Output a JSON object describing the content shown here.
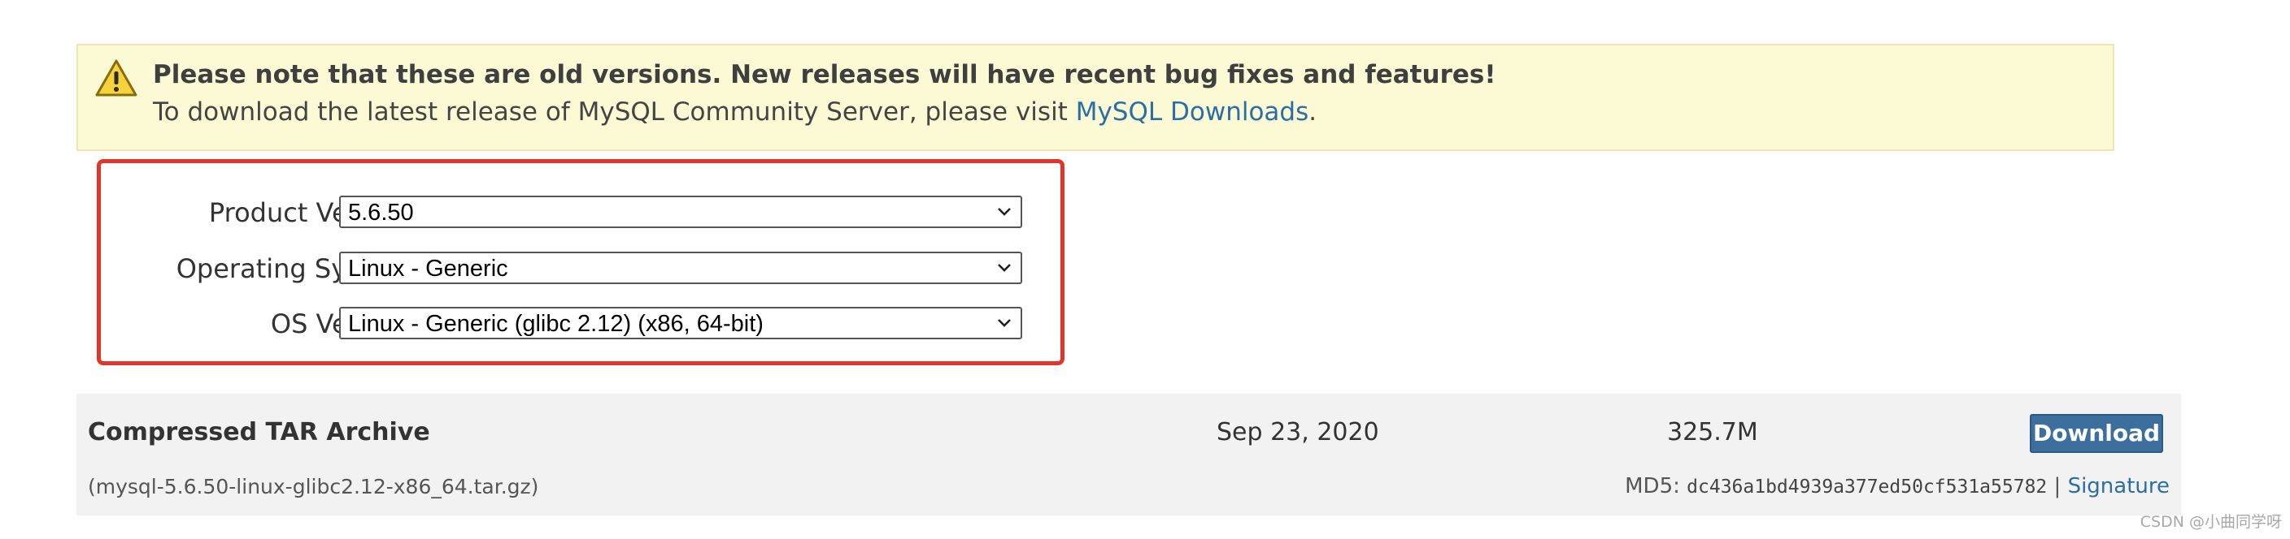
{
  "notice": {
    "headline": "Please note that these are old versions. New releases will have recent bug fixes and features!",
    "body_prefix": "To download the latest release of MySQL Community Server, please visit ",
    "link_text": "MySQL Downloads",
    "body_suffix": ".",
    "icon": "warning-icon"
  },
  "selectors": {
    "product_version": {
      "label": "Product Version:",
      "value": "5.6.50"
    },
    "operating_system": {
      "label": "Operating System:",
      "value": "Linux - Generic"
    },
    "os_version": {
      "label": "OS Version:",
      "value": "Linux - Generic (glibc 2.12) (x86, 64-bit)"
    }
  },
  "package": {
    "name": "Compressed TAR Archive",
    "date": "Sep 23, 2020",
    "size": "325.7M",
    "download_label": "Download",
    "filename": "(mysql-5.6.50-linux-glibc2.12-x86_64.tar.gz)",
    "md5_label": "MD5: ",
    "md5": "dc436a1bd4939a377ed50cf531a55782",
    "separator": " | ",
    "signature_label": "Signature"
  },
  "watermark": "CSDN @小曲同学呀",
  "colors": {
    "notice_bg": "#fcfad5",
    "highlight_border": "#e0352b",
    "link": "#2a6ea6",
    "button": "#3c6f9e",
    "panel_bg": "#f2f2f2"
  }
}
